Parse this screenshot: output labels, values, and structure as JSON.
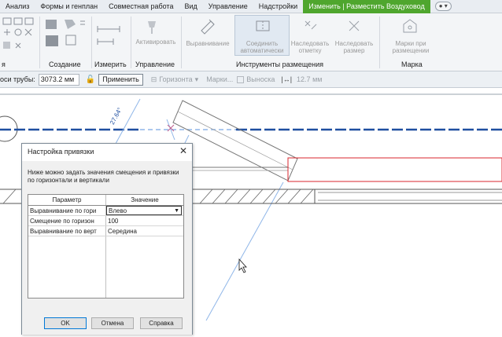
{
  "tabs": [
    "Анализ",
    "Формы и генплан",
    "Совместная работа",
    "Вид",
    "Управление",
    "Надстройки",
    "Изменить | Разместить Воздуховод"
  ],
  "ribbon": {
    "panels": {
      "left_partial": "я",
      "create": "Создание",
      "measure": "Измерить",
      "manage": "Управление",
      "placement_tools": "Инструменты размещения",
      "marks": "Марка"
    },
    "buttons": {
      "activate": "Активировать",
      "align": "Выравнивание",
      "auto_connect": "Соединить автоматически",
      "inherit_elevation": "Наследовать отметку",
      "inherit_size": "Наследовать размер",
      "tag_on_place": "Марки при размещении"
    }
  },
  "options_bar": {
    "offset_label": "оси трубы:",
    "offset_value": "3073.2 мм",
    "apply": "Применить",
    "horizontal": "Горизонта",
    "marks": "Марки...",
    "leader": "Выноска",
    "leader_length": "12.7 мм"
  },
  "canvas": {
    "angle_label": "27.64°"
  },
  "dialog": {
    "title": "Настройка привязки",
    "description": "Ниже можно задать значения смещения и привязки по горизонтали и вертикали",
    "columns": [
      "Параметр",
      "Значение"
    ],
    "rows": [
      {
        "param": "Выравнивание по гори",
        "value": "Влево"
      },
      {
        "param": "Смещение по горизон",
        "value": "100"
      },
      {
        "param": "Выравнивание по верт",
        "value": "Середина"
      }
    ],
    "ok": "OK",
    "cancel": "Отмена",
    "help": "Справка"
  },
  "colors": {
    "active_tab": "#4fa62e",
    "blue_line": "#1f4fa0",
    "light_blue": "#8fb6e8",
    "red": "#d9262c"
  }
}
